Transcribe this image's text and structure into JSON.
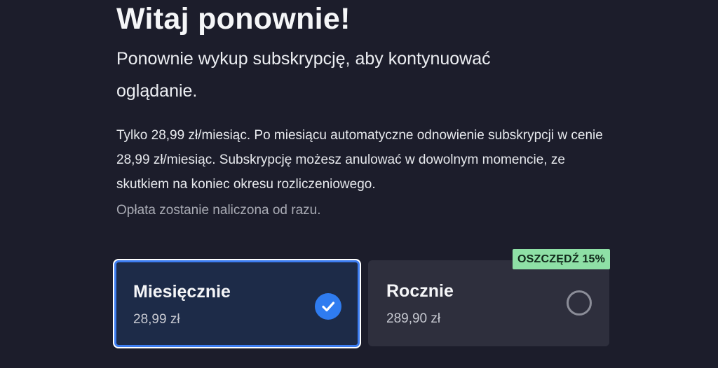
{
  "header": {
    "title": "Witaj ponownie!",
    "subtitle": "Ponownie wykup subskrypcję, aby kontynuować oglądanie."
  },
  "info": {
    "description": "Tylko 28,99 zł/miesiąc. Po miesiącu automatyczne odnowienie subskrypcji w cenie 28,99 zł/miesiąc. Subskrypcję możesz anulować w dowolnym momencie, ze skutkiem na koniec okresu rozliczeniowego.",
    "note": "Opłata zostanie naliczona od razu."
  },
  "plans": [
    {
      "name": "Miesięcznie",
      "price": "28,99 zł",
      "selected": true,
      "icon": "check-circle-icon"
    },
    {
      "name": "Rocznie",
      "price": "289,90 zł",
      "selected": false,
      "badge": "OSZCZĘDŹ 15%",
      "icon": "radio-empty-icon"
    }
  ],
  "colors": {
    "background": "#1c1d2b",
    "accent": "#2f7cf0",
    "selected_card": "#1d2b48",
    "unselected_card": "#2e2f3d",
    "badge": "#8ee0a6"
  }
}
